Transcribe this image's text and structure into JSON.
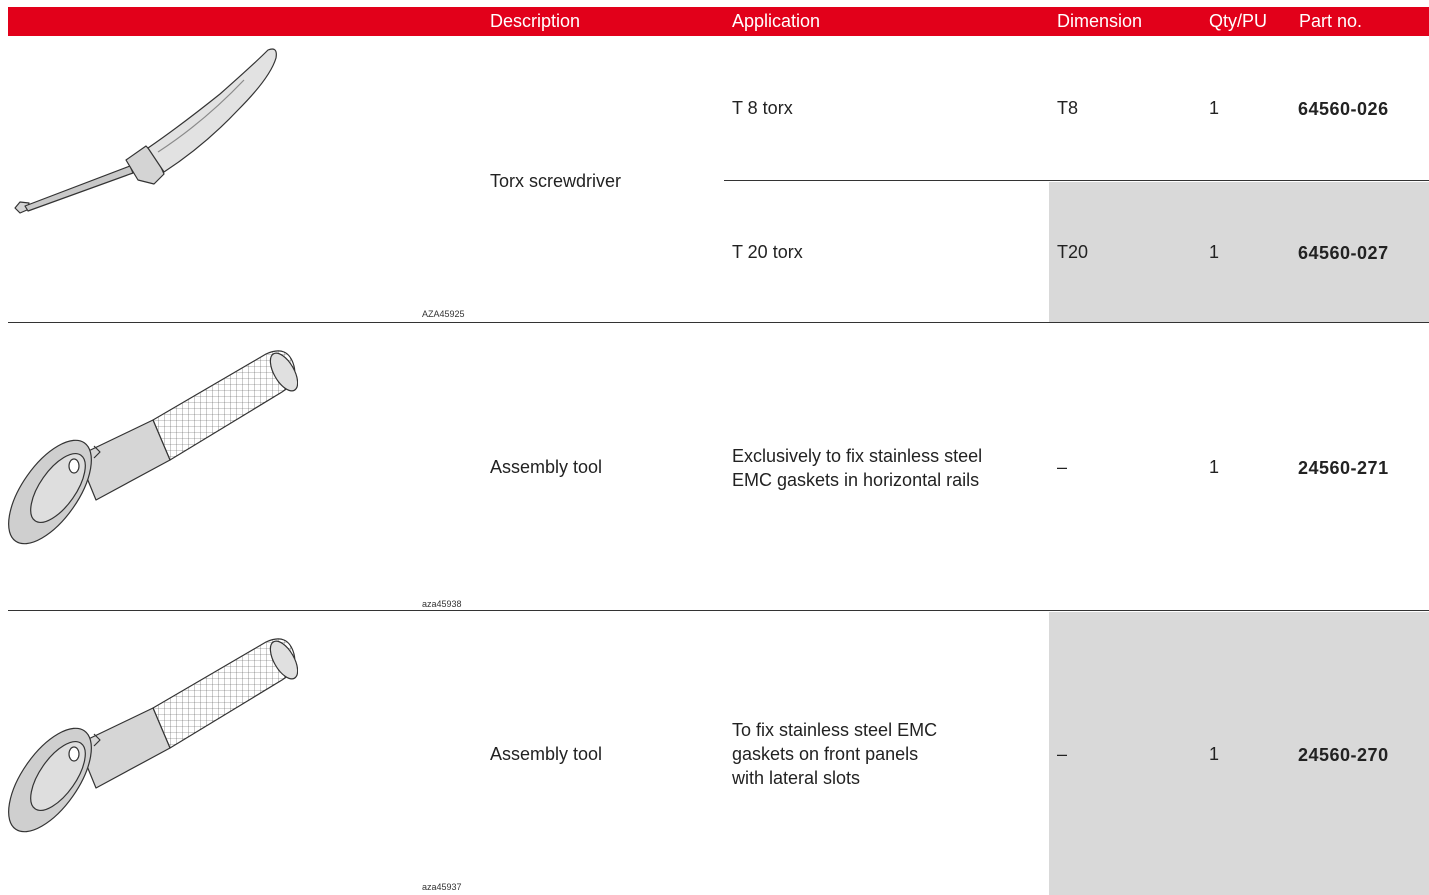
{
  "headers": {
    "description": "Description",
    "application": "Application",
    "dimension": "Dimension",
    "qty": "Qty/PU",
    "part_no": "Part no."
  },
  "rows": [
    {
      "description": "Torx screwdriver",
      "image_code": "AZA45925",
      "image_icon": "torx-screwdriver-icon",
      "variants": [
        {
          "application": "T 8 torx",
          "dimension": "T8",
          "qty": "1",
          "part_no": "64560-026"
        },
        {
          "application": "T 20 torx",
          "dimension": "T20",
          "qty": "1",
          "part_no": "64560-027"
        }
      ]
    },
    {
      "description": "Assembly tool",
      "image_code": "aza45938",
      "image_icon": "assembly-tool-icon",
      "application_lines": [
        "Exclusively to fix stainless steel",
        "EMC gaskets in horizontal rails"
      ],
      "dimension": "–",
      "qty": "1",
      "part_no": "24560-271"
    },
    {
      "description": "Assembly tool",
      "image_code": "aza45937",
      "image_icon": "assembly-tool-icon",
      "application_lines": [
        "To fix stainless steel EMC",
        "gaskets on front panels",
        "with lateral slots"
      ],
      "dimension": "–",
      "qty": "1",
      "part_no": "24560-270"
    }
  ],
  "colors": {
    "header_bg": "#e2001a",
    "shaded_bg": "#d9d9d9"
  }
}
